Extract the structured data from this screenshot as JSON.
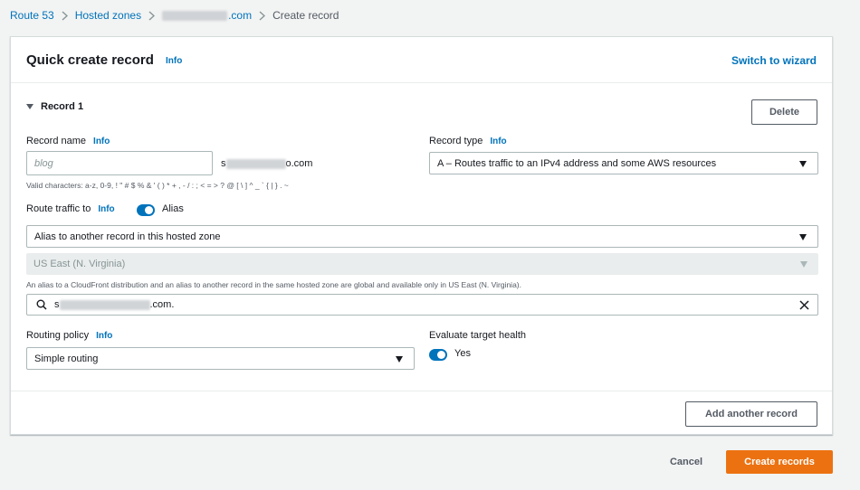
{
  "breadcrumb": {
    "items": [
      "Route 53",
      "Hosted zones",
      ".com",
      "Create record"
    ]
  },
  "card": {
    "title": "Quick create record",
    "info": "Info",
    "switch_wizard": "Switch to wizard"
  },
  "record": {
    "section_label": "Record 1",
    "delete_label": "Delete",
    "record_name": {
      "label": "Record name",
      "info": "Info",
      "placeholder": "blog",
      "suffix_prefix": "s",
      "suffix": "o.com",
      "hint": "Valid characters: a-z, 0-9, ! \" # $ % & ' ( ) * + , - / : ; < = > ? @ [ \\ ] ^ _ ` { | } . ~"
    },
    "record_type": {
      "label": "Record type",
      "info": "Info",
      "value": "A – Routes traffic to an IPv4 address and some AWS resources"
    },
    "route_traffic": {
      "label": "Route traffic to",
      "info": "Info",
      "alias_label": "Alias",
      "alias_enabled": true,
      "endpoint_value": "Alias to another record in this hosted zone",
      "region_value": "US East (N. Virginia)",
      "region_hint": "An alias to a CloudFront distribution and an alias to another record in the same hosted zone are global and available only in US East (N. Virginia).",
      "target_prefix": "s",
      "target_suffix": ".com."
    },
    "routing_policy": {
      "label": "Routing policy",
      "info": "Info",
      "value": "Simple routing"
    },
    "evaluate_health": {
      "label": "Evaluate target health",
      "value_label": "Yes",
      "enabled": true
    }
  },
  "footer": {
    "add_record": "Add another record",
    "cancel": "Cancel",
    "create": "Create records"
  },
  "colors": {
    "link": "#0073bb",
    "primary_button": "#ec7211",
    "toggle_on": "#0073bb"
  }
}
